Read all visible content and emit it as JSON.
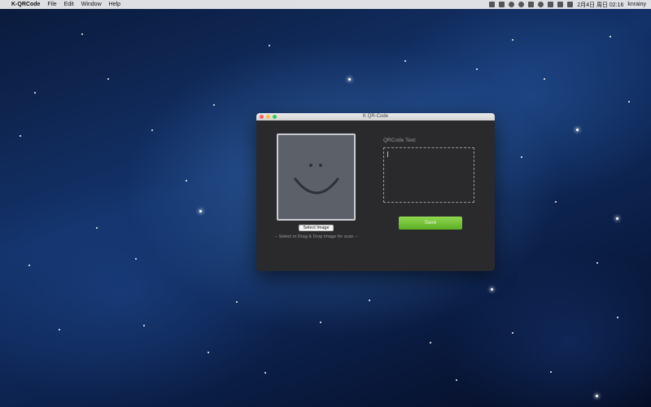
{
  "menubar": {
    "apple_glyph": "",
    "app_name": "K-QRCode",
    "menus": [
      "File",
      "Edit",
      "Window",
      "Help"
    ],
    "clock": "2月4日 周日  02:16",
    "user": "knrainy",
    "status_icons": [
      "s-icon",
      "lock-icon",
      "cloud-icon",
      "qq-icon",
      "bluetooth-icon",
      "wifi-icon",
      "volume-icon",
      "battery-icon",
      "flag-icon"
    ]
  },
  "window": {
    "title": "K QR-Code"
  },
  "left_panel": {
    "select_button_label": "Select Image",
    "hint": "-- Select or Drag & Drop Image for scan --"
  },
  "right_panel": {
    "qr_label": "QRCode Text:",
    "qr_text_value": "",
    "save_button_label": "Save"
  },
  "colors": {
    "save_green": "#6cbf32",
    "window_bg": "#2a2a2c",
    "image_well_bg": "#5c6068"
  }
}
